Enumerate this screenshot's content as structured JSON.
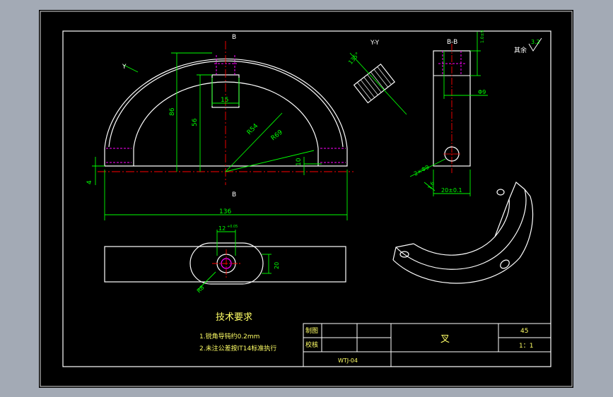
{
  "colors": {
    "background": "#a3aab5",
    "paper": "#000000",
    "line": "#ffffff",
    "dimension": "#00ff00",
    "center": "#ff0000",
    "hidden": "#ff00ff",
    "text": "#ffff66",
    "frame": "#ffffff"
  },
  "section_labels": {
    "b_top": "B",
    "b_bottom": "B",
    "view_y": "Y",
    "view_yy": "Y-Y",
    "section_bb": "B-B"
  },
  "dimensions": {
    "d15": "15",
    "d56": "56",
    "d86": "86",
    "r54": "R54",
    "r69": "R69",
    "d10": "10",
    "d4": "4",
    "d136": "136",
    "d12": "12",
    "d12_tol": "+0.05",
    "d20": "20",
    "r8": "R8",
    "d09": "Φ9",
    "d20pm": "20±0.1",
    "chamfer": "2×Φ9",
    "d1_6": "1.6",
    "angle135": "135°",
    "hole": "Φ8.5"
  },
  "roughness": {
    "label": "其余",
    "value": "3.2"
  },
  "tech_requirements": {
    "title": "技术要求",
    "line1": "1.锐角导钝约0.2mm",
    "line2": "2.未注公差按IT14标准执行"
  },
  "title_block": {
    "drawn_label": "制图",
    "check_label": "校核",
    "part_name": "叉",
    "material": "45",
    "scale": "1：1",
    "drawing_no": "WTJ-04"
  }
}
